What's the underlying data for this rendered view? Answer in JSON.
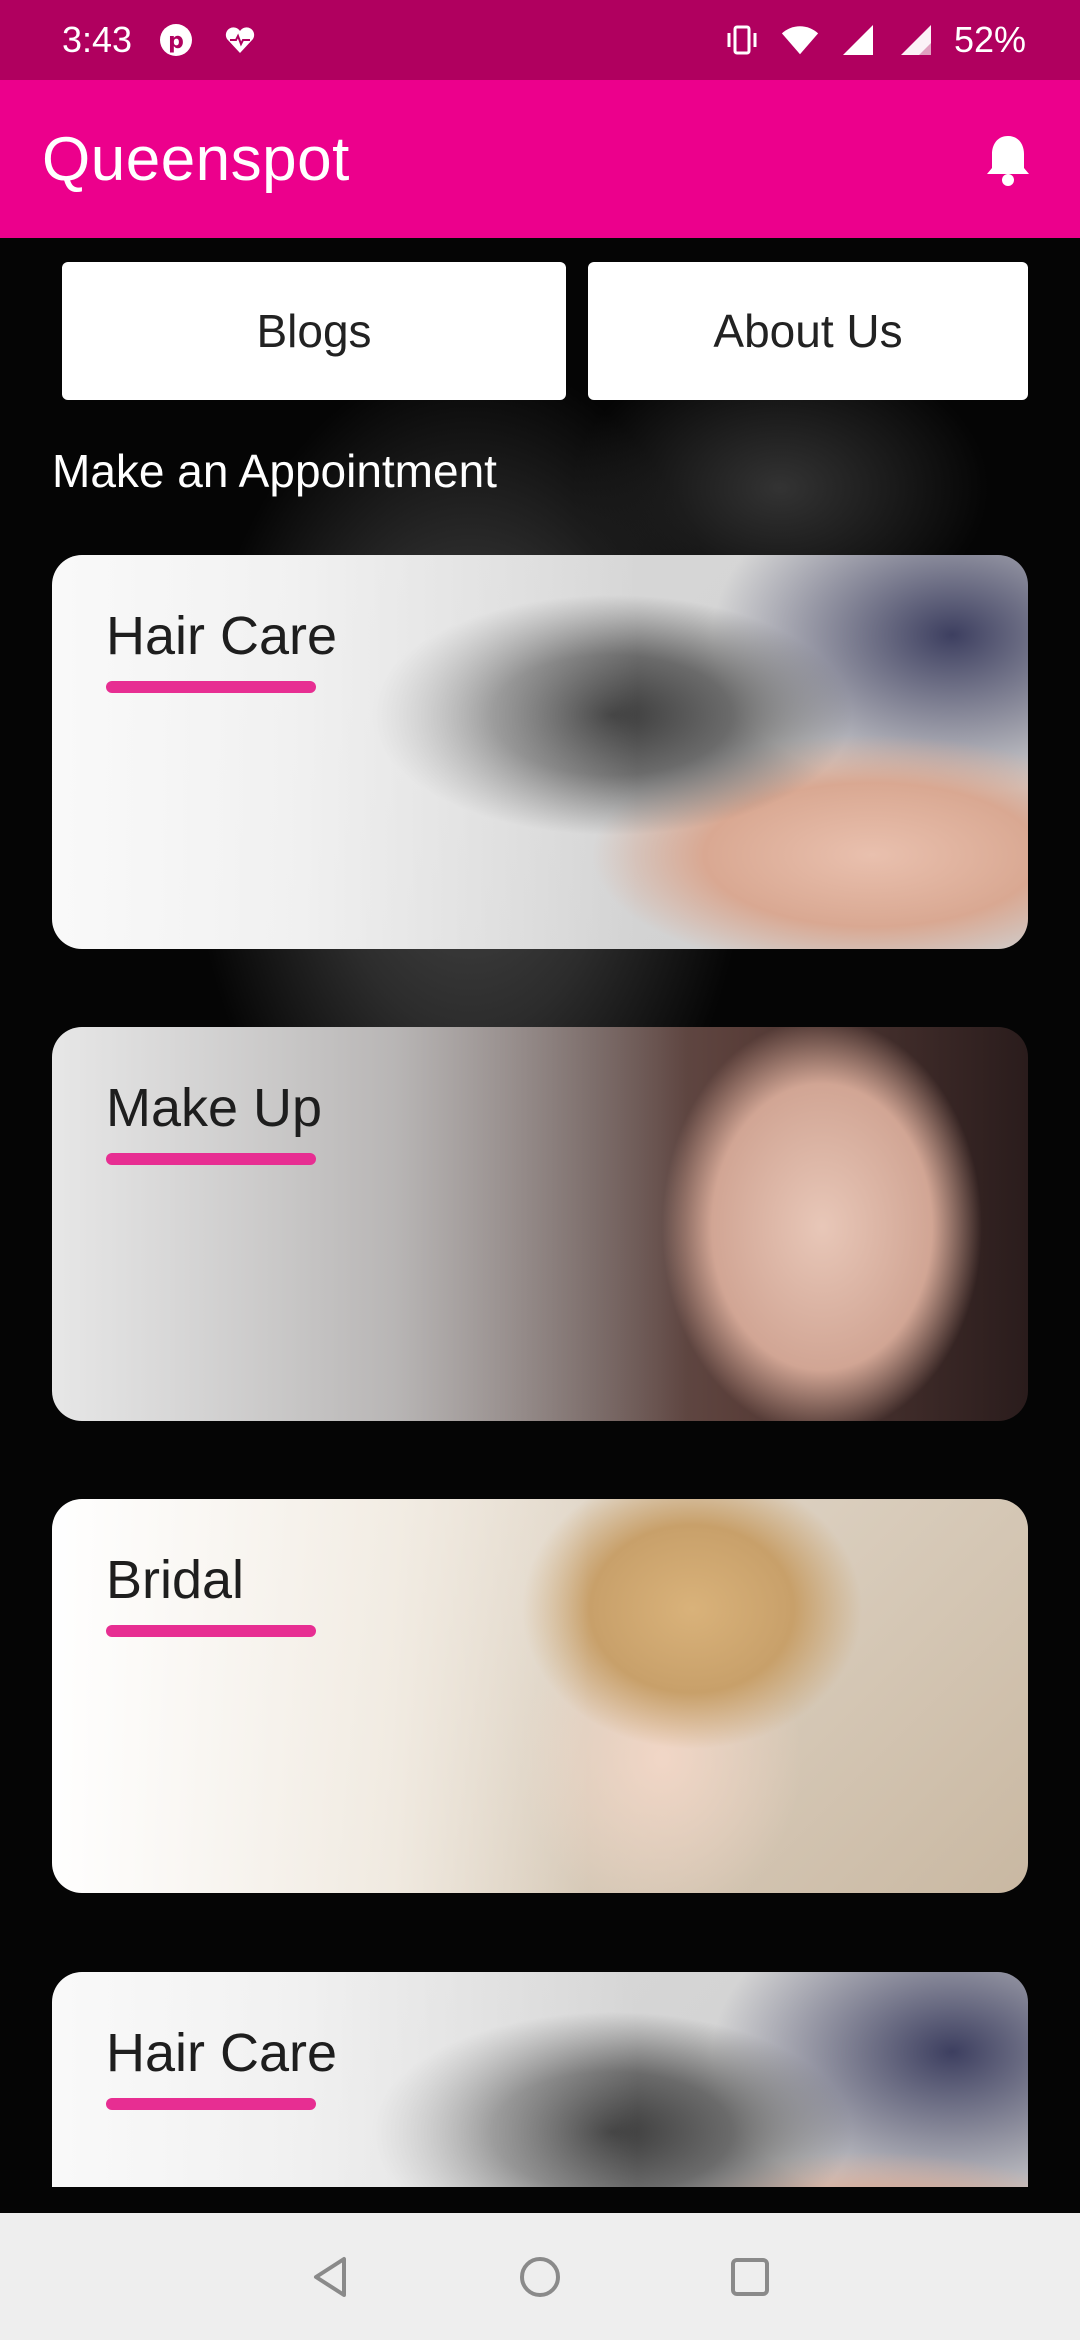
{
  "status_bar": {
    "time": "3:43",
    "battery": "52%",
    "left_icons": [
      "pinterest-icon",
      "health-heart-icon"
    ],
    "right_icons": [
      "vibrate-icon",
      "wifi-icon",
      "signal-icon",
      "signal-icon-2"
    ]
  },
  "app_bar": {
    "title": "Queenspot",
    "notification_icon": "bell-icon",
    "color": "#ec008c"
  },
  "top_buttons": {
    "blogs": "Blogs",
    "about": "About Us"
  },
  "section": {
    "title": "Make an Appointment"
  },
  "services": [
    {
      "label": "Hair Care"
    },
    {
      "label": "Make Up"
    },
    {
      "label": "Bridal"
    },
    {
      "label": "Hair Care"
    }
  ],
  "colors": {
    "status_bar": "#b0005f",
    "accent": "#ec008c",
    "underline": "#e72e92"
  },
  "nav_bar": {
    "icons": [
      "back-icon",
      "home-icon",
      "recents-icon"
    ]
  }
}
